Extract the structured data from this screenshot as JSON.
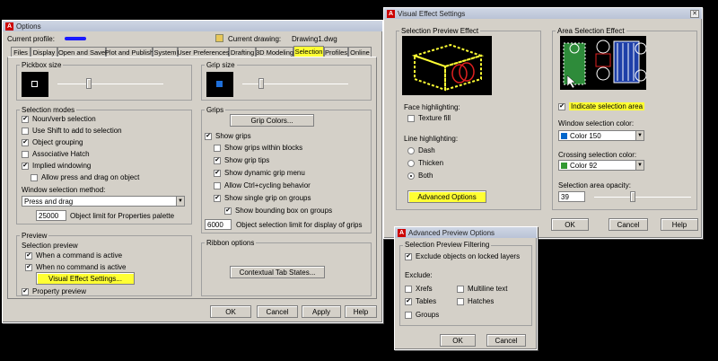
{
  "options": {
    "title": "Options",
    "current_profile_label": "Current profile:",
    "current_drawing_label": "Current drawing:",
    "current_drawing": "Drawing1.dwg",
    "tabs": [
      "Files",
      "Display",
      "Open and Save",
      "Plot and Publish",
      "System",
      "User Preferences",
      "Drafting",
      "3D Modeling",
      "Selection",
      "Profiles",
      "Online"
    ],
    "pickbox_title": "Pickbox size",
    "grip_size_title": "Grip size",
    "selection_modes_title": "Selection modes",
    "selection_modes": [
      {
        "label": "Noun/verb selection",
        "checked": true
      },
      {
        "label": "Use Shift to add to selection",
        "checked": false
      },
      {
        "label": "Object grouping",
        "checked": true
      },
      {
        "label": "Associative Hatch",
        "checked": false
      },
      {
        "label": "Implied windowing",
        "checked": true
      },
      {
        "label": "Allow press and drag on object",
        "checked": false
      }
    ],
    "window_method_label": "Window selection method:",
    "window_method_value": "Press and drag",
    "object_limit_value": "25000",
    "object_limit_label": "Object limit for Properties palette",
    "grips_title": "Grips",
    "grip_colors_button": "Grip Colors...",
    "grips": [
      {
        "label": "Show grips",
        "checked": true
      },
      {
        "label": "Show grips within blocks",
        "checked": false
      },
      {
        "label": "Show grip tips",
        "checked": true
      },
      {
        "label": "Show dynamic grip menu",
        "checked": true
      },
      {
        "label": "Allow Ctrl+cycling behavior",
        "checked": false
      },
      {
        "label": "Show single grip on groups",
        "checked": true
      },
      {
        "label": "Show bounding box on groups",
        "checked": true
      }
    ],
    "grip_limit_value": "6000",
    "grip_limit_label": "Object selection limit for display of grips",
    "preview_title": "Preview",
    "selection_preview_label": "Selection preview",
    "preview_items": [
      {
        "label": "When a command is active",
        "checked": true
      },
      {
        "label": "When no command is active",
        "checked": true
      }
    ],
    "visual_effect_button": "Visual Effect Settings...",
    "property_preview": {
      "label": "Property preview",
      "checked": true
    },
    "ribbon_title": "Ribbon options",
    "contextual_button": "Contextual Tab States...",
    "buttons": {
      "ok": "OK",
      "cancel": "Cancel",
      "apply": "Apply",
      "help": "Help"
    }
  },
  "visual": {
    "title": "Visual Effect Settings",
    "preview_group": "Selection Preview Effect",
    "area_group": "Area Selection Effect",
    "face_label": "Face highlighting:",
    "texture_fill": {
      "label": "Texture fill",
      "checked": false
    },
    "line_label": "Line highlighting:",
    "radios": [
      {
        "label": "Dash",
        "on": false
      },
      {
        "label": "Thicken",
        "on": false
      },
      {
        "label": "Both",
        "on": true
      }
    ],
    "advanced_button": "Advanced Options",
    "indicate_area": {
      "label": "Indicate selection area",
      "checked": true
    },
    "window_color_label": "Window selection color:",
    "window_color": {
      "name": "Color 150",
      "hex": "#0066cc"
    },
    "crossing_color_label": "Crossing selection color:",
    "crossing_color": {
      "name": "Color 92",
      "hex": "#339933"
    },
    "opacity_label": "Selection area opacity:",
    "opacity_value": "39",
    "buttons": {
      "ok": "OK",
      "cancel": "Cancel",
      "help": "Help"
    }
  },
  "advanced": {
    "title": "Advanced Preview Options",
    "filter_group": "Selection Preview Filtering",
    "exclude_locked": {
      "label": "Exclude objects on locked layers",
      "checked": true
    },
    "exclude_label": "Exclude:",
    "items": [
      {
        "label": "Xrefs",
        "checked": false
      },
      {
        "label": "Multiline text",
        "checked": false
      },
      {
        "label": "Tables",
        "checked": true
      },
      {
        "label": "Hatches",
        "checked": false
      },
      {
        "label": "Groups",
        "checked": false
      }
    ],
    "buttons": {
      "ok": "OK",
      "cancel": "Cancel"
    }
  },
  "colors": {
    "highlight": "#ffff33",
    "dialog": "#d4d0c8",
    "grip": "#1e6fd9",
    "blue_marker": "#1a1aff"
  }
}
